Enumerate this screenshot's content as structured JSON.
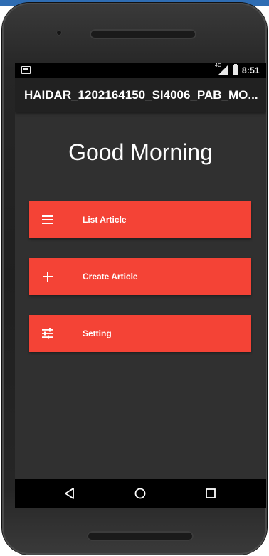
{
  "status_bar": {
    "network": "4G",
    "time": "8:51"
  },
  "app_bar": {
    "title": "HAIDAR_1202164150_SI4006_PAB_MO..."
  },
  "main": {
    "greeting": "Good Morning",
    "buttons": [
      {
        "label": "List Article",
        "icon": "menu-icon"
      },
      {
        "label": "Create Article",
        "icon": "plus-icon"
      },
      {
        "label": "Setting",
        "icon": "tune-icon"
      }
    ]
  },
  "nav_bar": {
    "items": [
      "back-icon",
      "home-icon",
      "recent-apps-icon"
    ]
  },
  "colors": {
    "accent": "#f44336",
    "background": "#303030",
    "app_bar": "#212121",
    "status_bar": "#000000"
  }
}
